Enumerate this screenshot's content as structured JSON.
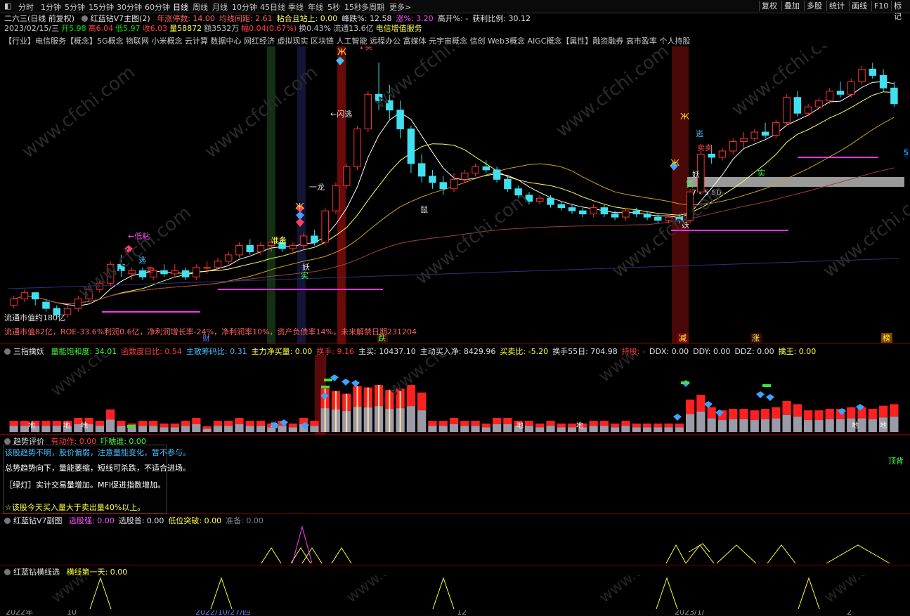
{
  "toolbar": {
    "periods": [
      "分时",
      "1分钟",
      "5分钟",
      "15分钟",
      "30分钟",
      "60分钟",
      "日线",
      "周线",
      "月线",
      "10分钟",
      "45日线",
      "季线",
      "年线",
      "5秒",
      "15秒",
      "多周期",
      "更多>"
    ],
    "active_period": "日线",
    "right_buttons": [
      "复权",
      "叠加",
      "多股",
      "统计",
      "画线",
      "F10",
      "标记"
    ]
  },
  "main_chart": {
    "header_line1": {
      "title": "二六三(日线 前复权)",
      "indicator": "红蓝钻V7主图(2)",
      "stats": [
        {
          "text": "年涨停数: 14.00",
          "color": "#ff6060"
        },
        {
          "text": "均线间距: 2.61",
          "color": "#ff6060"
        },
        {
          "text": "粘合且站上: 0.00",
          "color": "#ffff60"
        },
        {
          "text": "峰跌%: 12.58",
          "color": "#e0e0e0"
        },
        {
          "text": "涨%: 3.20",
          "color": "#ff50ff"
        },
        {
          "text": "高开%: -",
          "color": "#e0e0e0"
        },
        {
          "text": "获利比例: 30.12",
          "color": "#e0e0e0"
        }
      ]
    },
    "header_line2": [
      {
        "text": "2023/02/15/三",
        "color": "#c0c0c0"
      },
      {
        "text": "开5.98",
        "color": "#00e000"
      },
      {
        "text": "高6.04",
        "color": "#ff4040"
      },
      {
        "text": "低5.97",
        "color": "#00e000"
      },
      {
        "text": "收6.03",
        "color": "#ff4040"
      },
      {
        "text": "量58872",
        "color": "#ffff40"
      },
      {
        "text": "额3532万",
        "color": "#c0c0c0"
      },
      {
        "text": "幅0.04(0.67%)",
        "color": "#ff4040"
      },
      {
        "text": "换0.43%",
        "color": "#c0c0c0"
      },
      {
        "text": "流通13.6亿",
        "color": "#c0c0c0"
      },
      {
        "text": "电信增值服务",
        "color": "#ffff40"
      }
    ],
    "concepts_line": "【行业】电信服务【概念】5G概念 物联网 小米概念 云计算 数据中心 网红经济 虚拟现实 区块链 人工智能 远程办公 富媒体 元宇宙概念 信创 Web3概念 AIGC概念【属性】融资融券 高市盈率 个人持股",
    "footer_info": "流通市值82亿，ROE-33.6%利润0.6亿，净利润增长率-24%，净利润率10%，资产负债率14%，未来解禁日期231204",
    "market_value_label": "流通市值约180亿",
    "price_label_right": "5",
    "annotations": {
      "di_zhan": "←低粘",
      "tao1": "逃",
      "mai_sell": "卖",
      "zhun_bei": "准备",
      "yao1": "妖",
      "shi_mai": "实",
      "yi_long": "一龙",
      "shu": "鼠",
      "top_sell": "↓卖",
      "shan_tao": "←闪逃",
      "tao2": "逃",
      "mai2": "卖卖",
      "yao2": "妖",
      "yao3": "妖",
      "range_text": "7 - 5.60",
      "shi2": "实",
      "shi3": "实"
    },
    "bottom_tags": [
      "财",
      "跌",
      "减",
      "涨",
      "榜"
    ]
  },
  "panel_volume": {
    "name": "三指擒妖",
    "stats": [
      {
        "text": "量能饱和度: 34.01",
        "color": "#40ff40"
      },
      {
        "text": "函数度日比: 0.54",
        "color": "#ff4040"
      },
      {
        "text": "主散筹码比: 0.31",
        "color": "#40c0ff"
      },
      {
        "text": "主力净买量: 0.00",
        "color": "#ffff40"
      },
      {
        "text": "换手: 9.16",
        "color": "#ff4040"
      },
      {
        "text": "主买: 10437.10",
        "color": "#e0e0e0"
      },
      {
        "text": "主动买入净: 8429.96",
        "color": "#e0e0e0"
      },
      {
        "text": "买卖比: -5.20",
        "color": "#ffff40"
      },
      {
        "text": "换手55日: 704.98",
        "color": "#e0e0e0"
      },
      {
        "text": "持股: -",
        "color": "#ff4040"
      },
      {
        "text": "DDX: 0.00",
        "color": "#e0e0e0"
      },
      {
        "text": "DDY: 0.00",
        "color": "#e0e0e0"
      },
      {
        "text": "DDZ: 0.00",
        "color": "#e0e0e0"
      },
      {
        "text": "擒王: 0.00",
        "color": "#ffff40"
      }
    ],
    "mark_char": "地"
  },
  "panel_trend": {
    "name": "趋势评价",
    "stats": [
      {
        "text": "有动作: 0.00",
        "color": "#ff4040"
      },
      {
        "text": "吓唬谁: 0.00",
        "color": "#40ff40"
      }
    ],
    "messages": [
      {
        "text": "该股趋势不明，股价偏弱，注意量能变化，暂不参与。",
        "color": "#40c0ff"
      },
      {
        "text": "总势趋势向下，量能萎缩，短线可杀跌，不适合进场。",
        "color": "#ffffff"
      },
      {
        "text": "［绿灯］实计交易量增加。MFI促进指数增加。",
        "color": "#ffffff"
      },
      {
        "text": "☆该股今天买入量大于卖出量40%以上。",
        "color": "#ffff40"
      }
    ],
    "right_label": "顶背"
  },
  "panel_sub": {
    "name": "红蓝钻V7副图",
    "stats": [
      {
        "text": "选股强: 0.00",
        "color": "#ff50ff"
      },
      {
        "text": "选股普: 0.00",
        "color": "#e0e0e0"
      },
      {
        "text": "低位突破: 0.00",
        "color": "#ffff40"
      },
      {
        "text": "准备: 0.00",
        "color": "#808080"
      }
    ]
  },
  "panel_hx": {
    "name": "红蓝钻横线选",
    "stats": [
      {
        "text": "横线第一天: 0.00",
        "color": "#ffff40"
      }
    ]
  },
  "x_axis": {
    "labels": [
      "2022年",
      "10",
      "2022/10/27/四",
      "12",
      "2023/1/",
      "2"
    ]
  },
  "watermark": "www.cfchi.com",
  "chart_data": {
    "type": "candlestick",
    "title": "",
    "candles": [
      [
        5.3,
        5.6,
        5.5,
        5.2
      ],
      [
        5.5,
        5.8,
        5.7,
        5.4
      ],
      [
        5.7,
        5.7,
        5.5,
        5.3
      ],
      [
        5.4,
        5.5,
        5.2,
        5.1
      ],
      [
        5.2,
        5.3,
        5.0,
        4.9
      ],
      [
        5.0,
        5.3,
        5.2,
        4.9
      ],
      [
        5.2,
        5.6,
        5.5,
        5.1
      ],
      [
        5.5,
        5.9,
        5.8,
        5.4
      ],
      [
        5.8,
        6.1,
        6.0,
        5.7
      ],
      [
        6.0,
        6.7,
        6.6,
        5.9
      ],
      [
        6.6,
        6.9,
        6.4,
        6.2
      ],
      [
        6.3,
        6.5,
        6.4,
        6.1
      ],
      [
        6.4,
        6.5,
        6.2,
        6.1
      ],
      [
        6.2,
        6.5,
        6.4,
        6.1
      ],
      [
        6.4,
        6.6,
        6.3,
        6.2
      ],
      [
        6.3,
        6.6,
        6.4,
        6.2
      ],
      [
        6.4,
        6.5,
        6.2,
        6.1
      ],
      [
        6.2,
        6.6,
        6.5,
        6.1
      ],
      [
        6.5,
        6.7,
        6.5,
        6.3
      ],
      [
        6.5,
        6.8,
        6.7,
        6.4
      ],
      [
        6.7,
        7.0,
        6.9,
        6.6
      ],
      [
        6.9,
        7.3,
        7.2,
        6.8
      ],
      [
        7.2,
        7.4,
        7.0,
        6.9
      ],
      [
        7.0,
        7.3,
        7.2,
        6.9
      ],
      [
        7.2,
        7.4,
        7.3,
        7.0
      ],
      [
        7.3,
        7.5,
        7.1,
        7.0
      ],
      [
        7.1,
        7.3,
        7.2,
        7.0
      ],
      [
        7.2,
        7.6,
        7.5,
        7.1
      ],
      [
        7.5,
        7.7,
        7.3,
        7.2
      ],
      [
        7.3,
        8.4,
        8.3,
        7.2
      ],
      [
        8.3,
        9.2,
        9.1,
        8.2
      ],
      [
        9.1,
        9.8,
        9.7,
        9.0
      ],
      [
        9.7,
        11.0,
        10.9,
        9.6
      ],
      [
        10.9,
        12.1,
        12.0,
        10.8
      ],
      [
        12.0,
        13.0,
        11.8,
        11.5
      ],
      [
        11.8,
        12.3,
        11.5,
        11.2
      ],
      [
        11.5,
        11.8,
        10.9,
        10.6
      ],
      [
        10.9,
        11.0,
        9.8,
        9.5
      ],
      [
        9.8,
        10.1,
        9.4,
        9.2
      ],
      [
        9.4,
        9.6,
        9.2,
        9.0
      ],
      [
        9.2,
        9.4,
        9.0,
        8.8
      ],
      [
        9.0,
        9.5,
        9.3,
        8.9
      ],
      [
        9.3,
        9.6,
        9.5,
        9.2
      ],
      [
        9.5,
        9.8,
        9.7,
        9.4
      ],
      [
        9.7,
        9.9,
        9.6,
        9.5
      ],
      [
        9.6,
        9.7,
        9.3,
        9.2
      ],
      [
        9.3,
        9.4,
        9.0,
        8.9
      ],
      [
        9.0,
        9.1,
        8.8,
        8.7
      ],
      [
        8.8,
        8.9,
        8.6,
        8.5
      ],
      [
        8.6,
        8.8,
        8.7,
        8.5
      ],
      [
        8.7,
        8.8,
        8.5,
        8.4
      ],
      [
        8.5,
        8.6,
        8.4,
        8.3
      ],
      [
        8.4,
        8.5,
        8.3,
        8.2
      ],
      [
        8.3,
        8.4,
        8.2,
        8.1
      ],
      [
        8.2,
        8.5,
        8.4,
        8.1
      ],
      [
        8.4,
        8.5,
        8.2,
        8.1
      ],
      [
        8.2,
        8.3,
        8.1,
        8.0
      ],
      [
        8.1,
        8.4,
        8.3,
        8.0
      ],
      [
        8.3,
        8.4,
        8.2,
        8.1
      ],
      [
        8.2,
        8.3,
        8.1,
        8.0
      ],
      [
        8.1,
        8.2,
        8.0,
        7.9
      ],
      [
        8.0,
        8.2,
        8.1,
        7.9
      ],
      [
        8.1,
        8.2,
        8.0,
        7.9
      ],
      [
        8.0,
        9.0,
        8.9,
        7.9
      ],
      [
        8.9,
        10.2,
        10.1,
        8.8
      ],
      [
        10.1,
        10.4,
        10.0,
        9.8
      ],
      [
        10.0,
        10.3,
        10.2,
        9.9
      ],
      [
        10.2,
        10.6,
        10.5,
        10.1
      ],
      [
        10.5,
        10.8,
        10.6,
        10.3
      ],
      [
        10.6,
        10.9,
        10.8,
        10.5
      ],
      [
        10.8,
        11.1,
        10.7,
        10.6
      ],
      [
        10.7,
        11.2,
        11.1,
        10.6
      ],
      [
        11.1,
        12.0,
        11.9,
        11.0
      ],
      [
        11.9,
        12.1,
        11.4,
        11.3
      ],
      [
        11.4,
        11.7,
        11.6,
        11.3
      ],
      [
        11.6,
        11.9,
        11.8,
        11.5
      ],
      [
        11.8,
        12.2,
        12.1,
        11.7
      ],
      [
        12.1,
        12.4,
        12.0,
        11.9
      ],
      [
        12.0,
        12.5,
        12.4,
        11.9
      ],
      [
        12.4,
        12.9,
        12.8,
        12.3
      ],
      [
        12.8,
        13.0,
        12.6,
        12.5
      ],
      [
        12.6,
        12.8,
        12.2,
        12.1
      ],
      [
        12.2,
        12.4,
        11.7,
        11.6
      ]
    ]
  }
}
